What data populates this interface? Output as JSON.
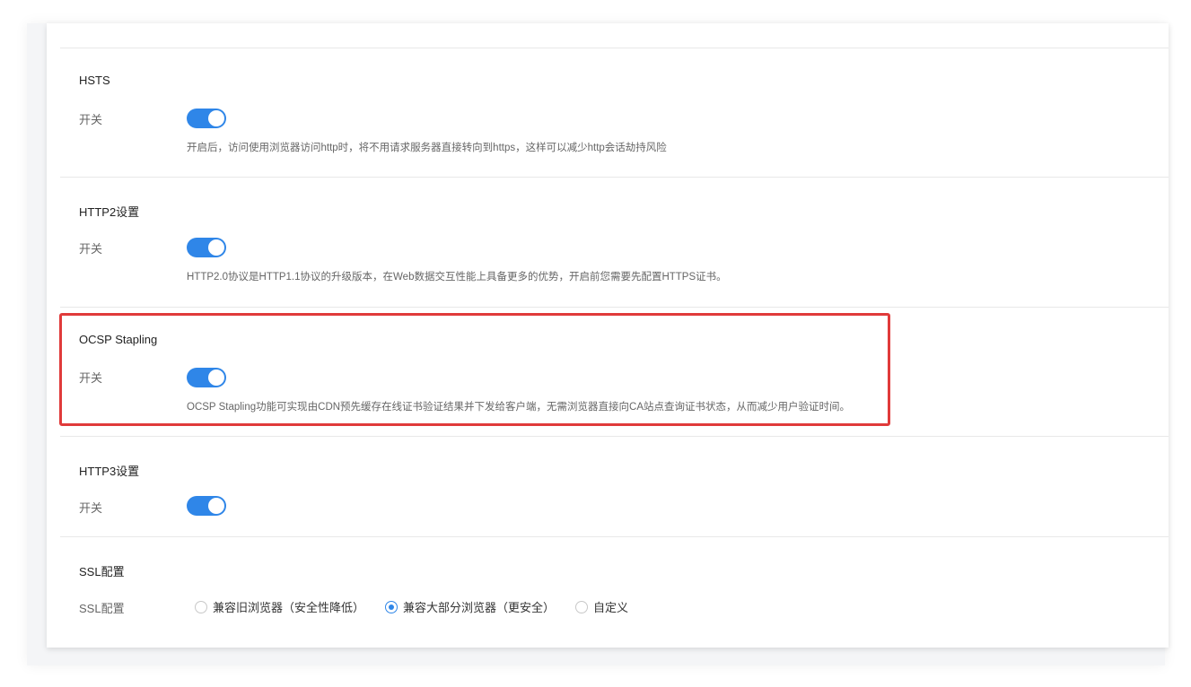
{
  "sections": {
    "hsts": {
      "title": "HSTS",
      "switch_label": "开关",
      "enabled": true,
      "description": "开启后，访问使用浏览器访问http时，将不用请求服务器直接转向到https，这样可以减少http会话劫持风险"
    },
    "http2": {
      "title": "HTTP2设置",
      "switch_label": "开关",
      "enabled": true,
      "description": "HTTP2.0协议是HTTP1.1协议的升级版本，在Web数据交互性能上具备更多的优势，开启前您需要先配置HTTPS证书。"
    },
    "ocsp": {
      "title": "OCSP Stapling",
      "switch_label": "开关",
      "enabled": true,
      "description": "OCSP Stapling功能可实现由CDN预先缓存在线证书验证结果并下发给客户端，无需浏览器直接向CA站点查询证书状态，从而减少用户验证时间。"
    },
    "http3": {
      "title": "HTTP3设置",
      "switch_label": "开关",
      "enabled": true
    },
    "ssl": {
      "title": "SSL配置",
      "row_label": "SSL配置",
      "options": [
        {
          "label": "兼容旧浏览器（安全性降低）",
          "checked": false
        },
        {
          "label": "兼容大部分浏览器（更安全）",
          "checked": true
        },
        {
          "label": "自定义",
          "checked": false
        }
      ]
    }
  },
  "colors": {
    "accent": "#2f86e8",
    "highlight_border": "#e03a3a"
  }
}
